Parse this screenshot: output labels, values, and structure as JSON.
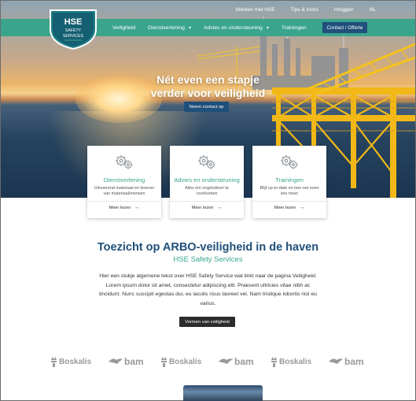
{
  "topnav": {
    "items": [
      "Werken met HSE",
      "Tips & tricks",
      "Inloggen",
      "NL"
    ]
  },
  "logo": {
    "line1": "HSE",
    "line2": "SAFETY",
    "line3": "SERVICES"
  },
  "nav": {
    "items": [
      {
        "label": "Veiligheid",
        "dropdown": false
      },
      {
        "label": "Dienstverlening",
        "dropdown": true
      },
      {
        "label": "Advies en ondersteuning",
        "dropdown": true
      },
      {
        "label": "Trainingen",
        "dropdown": false
      }
    ],
    "cta": "Contact / Offerte"
  },
  "hero": {
    "title_line1": "Nét even een stapje",
    "title_line2": "verder voor veiligheid",
    "button": "Neem contact op"
  },
  "cards": [
    {
      "title": "Dienstverlening",
      "desc": "Uitvoerend materiaal en leveren van materiaal/mensen",
      "more": "Meer lezen",
      "icon": "gears-icon"
    },
    {
      "title": "Advies en ondersteuning",
      "desc": "Alles om ongelukken te voorkomen",
      "more": "Meer lezen",
      "icon": "gears-icon"
    },
    {
      "title": "Trainingen",
      "desc": "Blijf up-to-date en leer net even iets meer",
      "more": "Meer lezen",
      "icon": "gears-icon"
    }
  ],
  "content": {
    "title": "Toezicht op ARBO-veiligheid in de haven",
    "subtitle": "HSE Safety Services",
    "body": "Hier een stukje algemene tekst over HSE Safety Service wat linkt naar de pagina Veiligheid. Lorem ipsum dolor sit amet, consectetur adipiscing elit. Praesent ultricies vitae nibh ac tincidunt. Nunc suscipit egestas dui, eu iaculis risus laoreet vel. Nam tristique lobortis nisl eu varius.",
    "button": "Vormen van veiligheid"
  },
  "partners": [
    "Boskalis",
    "bam",
    "Boskalis",
    "bam",
    "Boskalis",
    "bam"
  ],
  "colors": {
    "teal": "#3aa58c",
    "navy": "#1f4f7a",
    "dark_button": "#2c2c2c"
  }
}
